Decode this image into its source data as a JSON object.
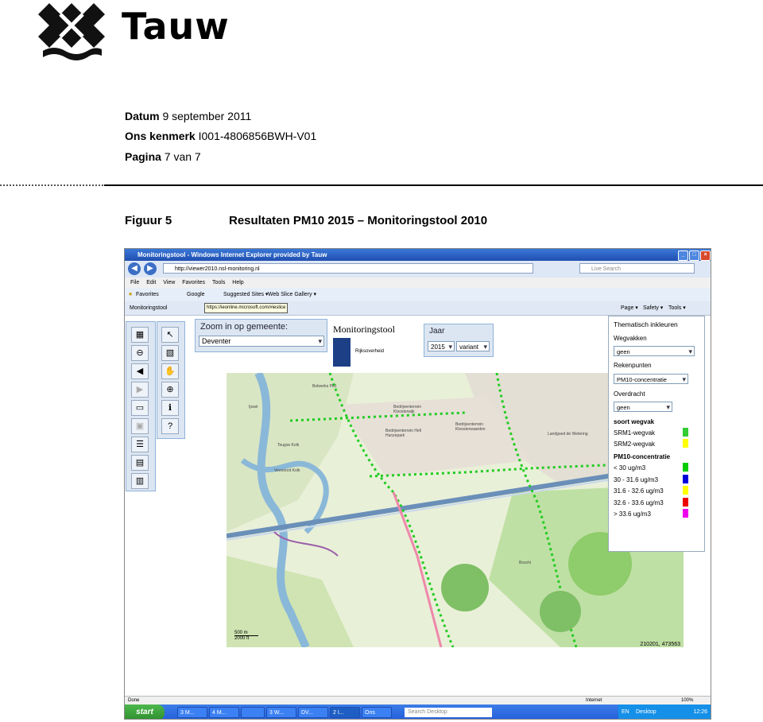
{
  "header": {
    "logo_text": "Tauw",
    "datum_label": "Datum",
    "datum_value": "9 september 2011",
    "kenmerk_label": "Ons kenmerk",
    "kenmerk_value": "I001-4806856BWH-V01",
    "pagina_label": "Pagina",
    "pagina_value": "7 van 7"
  },
  "figure": {
    "label": "Figuur 5",
    "title": "Resultaten PM10 2015 – Monitoringstool 2010"
  },
  "browser": {
    "title": "Monitoringstool - Windows Internet Explorer provided by Tauw",
    "url": "http://viewer2010.nsl-monitoring.nl",
    "search_placeholder": "Live Search",
    "menu": [
      "File",
      "Edit",
      "View",
      "Favorites",
      "Tools",
      "Help"
    ],
    "favorites_label": "Favorites",
    "google_label": "Google",
    "suggested_label": "Suggested Sites ▾",
    "slice_label": "Web Slice Gallery ▾",
    "tab_label": "Monitoringstool",
    "tooltip": "https://ieonline.microsoft.com/#ieslice",
    "cmd": [
      "Page ▾",
      "Safety ▾",
      "Tools ▾"
    ],
    "status_left": "Done",
    "status_zone": "Internet",
    "status_zoom": "100%"
  },
  "app": {
    "zoom_label": "Zoom in op gemeente:",
    "zoom_value": "Deventer",
    "brand_title": "Monitoringstool",
    "brand_org": "Rijksoverheid",
    "jaar_label": "Jaar",
    "jaar_value": "2015",
    "variant_value": "variant",
    "scale_m": "500 m",
    "scale_ft": "2000 ft",
    "coords": "210201, 473563",
    "places": [
      "Bolwerks Pb1",
      "Bedrijventerrein Kloosterwijk",
      "Bedrijventerrein Hell Hunzepark",
      "Bedrijventerrein Kloosterwaarden",
      "Ijssel",
      "Teugse Kolk",
      "Veenoord Kolk",
      "Landgoed de Wetering",
      "Boschi"
    ]
  },
  "legend": {
    "title": "Thematisch inkleuren",
    "wegvakken_label": "Wegvakken",
    "wegvakken_value": "geen",
    "rekenpunten_label": "Rekenpunten",
    "rekenpunten_value": "PM10-concentratie",
    "overdracht_label": "Overdracht",
    "overdracht_value": "geen",
    "soort_title": "soort wegvak",
    "items": [
      {
        "label": "SRM1-wegvak",
        "color": "#33cc33"
      },
      {
        "label": "SRM2-wegvak",
        "color": "#ffff00"
      }
    ],
    "pm_title": "PM10-concentratie",
    "pm_items": [
      {
        "label": "< 30 ug/m3",
        "color": "#00cc00"
      },
      {
        "label": "30 - 31.6 ug/m3",
        "color": "#0000dd"
      },
      {
        "label": "31.6 - 32.6 ug/m3",
        "color": "#ffff00"
      },
      {
        "label": "32.6 - 33.6 ug/m3",
        "color": "#ee0000"
      },
      {
        "label": "> 33.6 ug/m3",
        "color": "#ee00ee"
      }
    ]
  },
  "taskbar": {
    "start": "start",
    "tasks": [
      "3 M...",
      "4 M...",
      "",
      "3 W...",
      "DV...",
      "2 I...",
      "Ons"
    ],
    "search": "Search Desktop",
    "lang": "EN",
    "desktop": "Desktop",
    "time": "12:26"
  }
}
